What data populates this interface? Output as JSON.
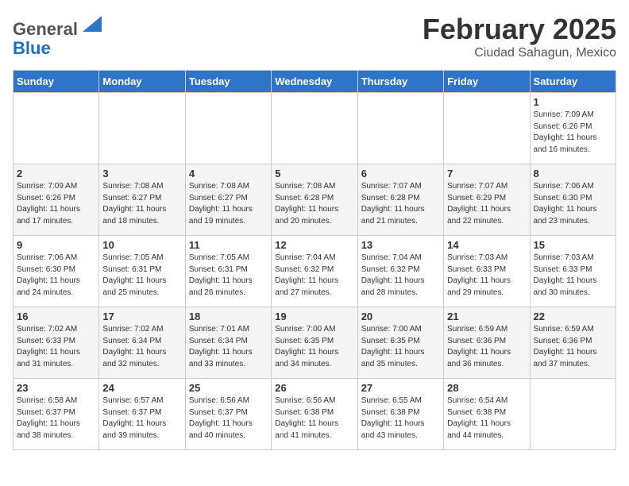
{
  "header": {
    "logo_line1": "General",
    "logo_line2": "Blue",
    "month": "February 2025",
    "location": "Ciudad Sahagun, Mexico"
  },
  "days_of_week": [
    "Sunday",
    "Monday",
    "Tuesday",
    "Wednesday",
    "Thursday",
    "Friday",
    "Saturday"
  ],
  "weeks": [
    [
      {
        "day": "",
        "info": ""
      },
      {
        "day": "",
        "info": ""
      },
      {
        "day": "",
        "info": ""
      },
      {
        "day": "",
        "info": ""
      },
      {
        "day": "",
        "info": ""
      },
      {
        "day": "",
        "info": ""
      },
      {
        "day": "1",
        "info": "Sunrise: 7:09 AM\nSunset: 6:26 PM\nDaylight: 11 hours\nand 16 minutes."
      }
    ],
    [
      {
        "day": "2",
        "info": "Sunrise: 7:09 AM\nSunset: 6:26 PM\nDaylight: 11 hours\nand 17 minutes."
      },
      {
        "day": "3",
        "info": "Sunrise: 7:08 AM\nSunset: 6:27 PM\nDaylight: 11 hours\nand 18 minutes."
      },
      {
        "day": "4",
        "info": "Sunrise: 7:08 AM\nSunset: 6:27 PM\nDaylight: 11 hours\nand 19 minutes."
      },
      {
        "day": "5",
        "info": "Sunrise: 7:08 AM\nSunset: 6:28 PM\nDaylight: 11 hours\nand 20 minutes."
      },
      {
        "day": "6",
        "info": "Sunrise: 7:07 AM\nSunset: 6:28 PM\nDaylight: 11 hours\nand 21 minutes."
      },
      {
        "day": "7",
        "info": "Sunrise: 7:07 AM\nSunset: 6:29 PM\nDaylight: 11 hours\nand 22 minutes."
      },
      {
        "day": "8",
        "info": "Sunrise: 7:06 AM\nSunset: 6:30 PM\nDaylight: 11 hours\nand 23 minutes."
      }
    ],
    [
      {
        "day": "9",
        "info": "Sunrise: 7:06 AM\nSunset: 6:30 PM\nDaylight: 11 hours\nand 24 minutes."
      },
      {
        "day": "10",
        "info": "Sunrise: 7:05 AM\nSunset: 6:31 PM\nDaylight: 11 hours\nand 25 minutes."
      },
      {
        "day": "11",
        "info": "Sunrise: 7:05 AM\nSunset: 6:31 PM\nDaylight: 11 hours\nand 26 minutes."
      },
      {
        "day": "12",
        "info": "Sunrise: 7:04 AM\nSunset: 6:32 PM\nDaylight: 11 hours\nand 27 minutes."
      },
      {
        "day": "13",
        "info": "Sunrise: 7:04 AM\nSunset: 6:32 PM\nDaylight: 11 hours\nand 28 minutes."
      },
      {
        "day": "14",
        "info": "Sunrise: 7:03 AM\nSunset: 6:33 PM\nDaylight: 11 hours\nand 29 minutes."
      },
      {
        "day": "15",
        "info": "Sunrise: 7:03 AM\nSunset: 6:33 PM\nDaylight: 11 hours\nand 30 minutes."
      }
    ],
    [
      {
        "day": "16",
        "info": "Sunrise: 7:02 AM\nSunset: 6:33 PM\nDaylight: 11 hours\nand 31 minutes."
      },
      {
        "day": "17",
        "info": "Sunrise: 7:02 AM\nSunset: 6:34 PM\nDaylight: 11 hours\nand 32 minutes."
      },
      {
        "day": "18",
        "info": "Sunrise: 7:01 AM\nSunset: 6:34 PM\nDaylight: 11 hours\nand 33 minutes."
      },
      {
        "day": "19",
        "info": "Sunrise: 7:00 AM\nSunset: 6:35 PM\nDaylight: 11 hours\nand 34 minutes."
      },
      {
        "day": "20",
        "info": "Sunrise: 7:00 AM\nSunset: 6:35 PM\nDaylight: 11 hours\nand 35 minutes."
      },
      {
        "day": "21",
        "info": "Sunrise: 6:59 AM\nSunset: 6:36 PM\nDaylight: 11 hours\nand 36 minutes."
      },
      {
        "day": "22",
        "info": "Sunrise: 6:59 AM\nSunset: 6:36 PM\nDaylight: 11 hours\nand 37 minutes."
      }
    ],
    [
      {
        "day": "23",
        "info": "Sunrise: 6:58 AM\nSunset: 6:37 PM\nDaylight: 11 hours\nand 38 minutes."
      },
      {
        "day": "24",
        "info": "Sunrise: 6:57 AM\nSunset: 6:37 PM\nDaylight: 11 hours\nand 39 minutes."
      },
      {
        "day": "25",
        "info": "Sunrise: 6:56 AM\nSunset: 6:37 PM\nDaylight: 11 hours\nand 40 minutes."
      },
      {
        "day": "26",
        "info": "Sunrise: 6:56 AM\nSunset: 6:38 PM\nDaylight: 11 hours\nand 41 minutes."
      },
      {
        "day": "27",
        "info": "Sunrise: 6:55 AM\nSunset: 6:38 PM\nDaylight: 11 hours\nand 43 minutes."
      },
      {
        "day": "28",
        "info": "Sunrise: 6:54 AM\nSunset: 6:38 PM\nDaylight: 11 hours\nand 44 minutes."
      },
      {
        "day": "",
        "info": ""
      }
    ]
  ]
}
